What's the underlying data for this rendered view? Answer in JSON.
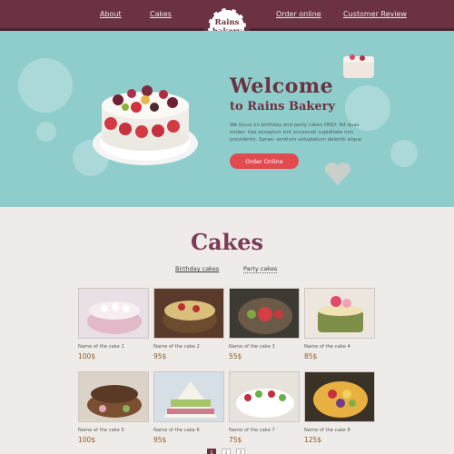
{
  "nav": {
    "about": "About",
    "cakes": "Cakes",
    "order": "Order online",
    "review": "Customer Review"
  },
  "logo": {
    "line1": "Rains",
    "line2": "bakery"
  },
  "hero": {
    "title": "Welcome",
    "subtitle": "to Rains Bakery",
    "text": "We focus on birthday and party cakes ONLY. Yet quas moles- tias excepturi sint occaecati cupiditate non providents. Sprae- sentium voluptatum deleniti atque",
    "button": "Order Online"
  },
  "section": {
    "title": "Cakes",
    "tabs": [
      "Birthday cakes",
      "Party cakes"
    ]
  },
  "cakes": [
    {
      "name": "Name of the cake 1",
      "price": "100$"
    },
    {
      "name": "Name of the cake 2",
      "price": "95$"
    },
    {
      "name": "Name of the cake 3",
      "price": "55$"
    },
    {
      "name": "Name of the cake 4",
      "price": "85$"
    },
    {
      "name": "Name of the cake 5",
      "price": "100$"
    },
    {
      "name": "Name of the cake 6",
      "price": "95$"
    },
    {
      "name": "Name of the cake 7",
      "price": "75$"
    },
    {
      "name": "Name of the cake 8",
      "price": "125$"
    }
  ],
  "pagination": [
    "1",
    "2",
    "3"
  ],
  "colors": {
    "header": "#6b3341",
    "hero": "#8fcccc",
    "button": "#e24a50",
    "accent": "#7a3d55"
  }
}
